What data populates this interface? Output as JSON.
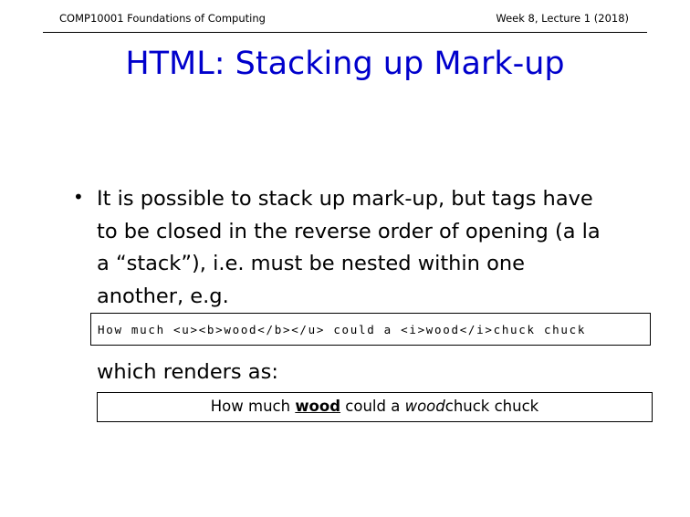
{
  "header": {
    "course": "COMP10001 Foundations of Computing",
    "lecture": "Week 8, Lecture 1 (2018)"
  },
  "slide": {
    "title": "HTML: Stacking up Mark-up",
    "bullet_symbol": "•",
    "bullet_lines": [
      "It is possible to stack up mark-up, but tags have",
      "to be closed in the reverse order of opening (a la",
      "a “stack”), i.e. must be nested within one",
      "another, e.g."
    ],
    "code_example": "How much <u><b>wood</b></u> could a <i>wood</i>chuck chuck",
    "renders_label": "which renders as:",
    "rendered": {
      "before": "How much ",
      "bold_underlined": "wood",
      "middle": " could a ",
      "italic": "wood",
      "after": "chuck chuck"
    }
  },
  "colors": {
    "title": "#0000cc",
    "text": "#000000",
    "background": "#ffffff"
  }
}
